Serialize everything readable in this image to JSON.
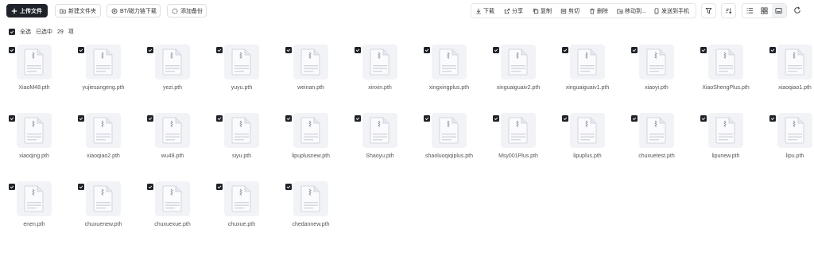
{
  "toolbar": {
    "upload_label": "上传文件",
    "new_folder_label": "新建文件夹",
    "bt_label": "BT/磁力链下载",
    "backup_label": "添加备份"
  },
  "actions": {
    "download": "下载",
    "share": "分享",
    "copy": "复制",
    "cut": "剪切",
    "delete": "删除",
    "move": "移动到...",
    "send_phone": "发送到手机"
  },
  "selection": {
    "select_all": "全选",
    "selected_prefix": "已选中",
    "count": "29",
    "suffix": "项"
  },
  "files": [
    "XiaoM48.pth",
    "yujiesangeng.pth",
    "yezi.pth",
    "yuyu.pth",
    "weinan.pth",
    "xinxin.pth",
    "xingxingplus.pth",
    "xinguaiguaiv2.pth",
    "xinguaiguaiv1.pth",
    "xiaoyi.pth",
    "XiaoShengPlus.pth",
    "xiaoqiao1.pth",
    "xiaoqing.pth",
    "xiaoqiao2.pth",
    "wu48.pth",
    "siyu.pth",
    "lipuplusnew.pth",
    "Shaoyu.pth",
    "shaoluoqiqiplus.pth",
    "Msy001Plus.pth",
    "lipuplus.pth",
    "chuxuetest.pth",
    "lipunew.pth",
    "lipu.pth",
    "enen.pth",
    "chuxuenew.pth",
    "chuxuexue.pth",
    "chuxue.pth",
    "chedannew.pth"
  ],
  "colors": {
    "primary": "#1f2329",
    "thumb_bg": "#f2f3f6",
    "doc_accent": "#8a93a3"
  }
}
